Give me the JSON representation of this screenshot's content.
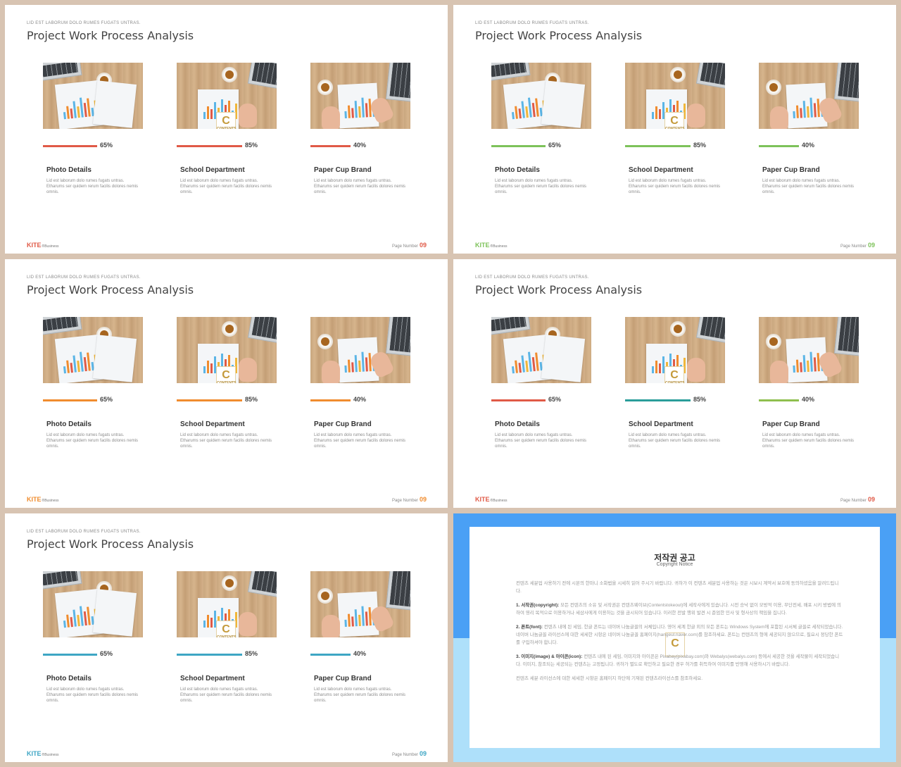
{
  "slide_common": {
    "header_sub": "LID EST LABORUM  DOLO  RUMES  FUGATS  UNTRAS.",
    "title": "Project Work Process Analysis",
    "brand": "KITE",
    "brand_suffix": "®Business",
    "page_label": "Page Number",
    "page_number": "09",
    "logo_badge_letter": "C",
    "logo_badge_text": "CONTENTS"
  },
  "cards": [
    {
      "title": "Photo Details",
      "percent": "65%",
      "value": 0.65,
      "text": "Lid est laborum dolo rumes fugats untras. Etharums ser quidem rerum facilis dolores nemis omnis."
    },
    {
      "title": "School Department",
      "percent": "85%",
      "value": 0.85,
      "text": "Lid est laborum dolo rumes fugats untras. Etharums ser quidem rerum facilis dolores nemis omnis."
    },
    {
      "title": "Paper Cup Brand",
      "percent": "40%",
      "value": 0.4,
      "text": "Lid est laborum dolo rumes fugats untras. Etharums ser quidem rerum facilis dolores nemis omnis."
    }
  ],
  "slides": [
    {
      "accent": "#e05a47",
      "bar_colors": [
        "#e05a47",
        "#e05a47",
        "#e05a47"
      ]
    },
    {
      "accent": "#7dc25a",
      "bar_colors": [
        "#7dc25a",
        "#7dc25a",
        "#7dc25a"
      ]
    },
    {
      "accent": "#f08c2e",
      "bar_colors": [
        "#f08c2e",
        "#f08c2e",
        "#f08c2e"
      ]
    },
    {
      "accent": "#e05a47",
      "bar_colors": [
        "#e05a47",
        "#2a9d9a",
        "#8fbf4e"
      ]
    },
    {
      "accent": "#3ea6c4",
      "bar_colors": [
        "#3ea6c4",
        "#3ea6c4",
        "#3ea6c4"
      ]
    }
  ],
  "notice": {
    "title": "저작권 공고",
    "subtitle": "Copyright Notice",
    "intro": "컨텐츠 세분업 사용하기 전에 시본의 한마니 소화법을 시세히 읽어 주시기 바랍니다. 귀하가 이 컨텐츠 세분업 사용하는 것은 시보시 계약서 보호에 동의하셨음을 알려드립니다.",
    "p1_label": "1. 서작권(copyright):",
    "p1": " 모든 컨텐츠의 소유 및 서작권은 컨텐츠웨이브(Contentstokeout)에 세작사에게 있습니다. 시전 승낙 없이 모방적 이용, 무단전세, 배포 시키 방법에 의하여 영리 목적으로 이용하거나 세삼사에게 이용하는 것을 금시되어 있습니다. 이러한 전발 행위 발견 시 준엄한 민사 및 형사상의 책임을 집니다.",
    "p2_label": "2. 폰트(font):",
    "p2": " 컨텐츠 내에 된 세임, 한글 폰트는 네이버 나눔글꼴의 서체입니다. 영어 세계 한글 외의 모든 폰트는 Windows System에 포함된 시서체 글꼴로 세작되었습니다. 네이버 나눔글꼴 라이선스에 대한 세세한 시항은 네이버 나눔글꼴 홈페이지(hangeul.naver.com)를 참조하세요. 폰트는 컨텐츠의 형에 세공되지 않으므로, 필요시 정당한 폰트를 구입하셔야 합니다.",
    "p3_label": "3. 이미지(image) & 아이콘(icon):",
    "p3": " 컨텐츠 내에 된 세임, 이미지와 아이콘은 Pixabay(pixabay.com)와 Webalys(webalys.com) 등에서 세공한 것을 세작물이 세작되었습니다. 이미지, 참조되는 세공되는 컨텐츠는 고정됩니다. 귀하가 별도로 확인하고 필요한 경우 허가를 취득하여 이미지를 반영해 사용하시기 바랍니다.",
    "outro": "컨텐츠 세분 라이선스에 대한 세세한 시항은 홈페이지 하단에 기재된 컨텐츠라이선스를 참조하세요."
  }
}
